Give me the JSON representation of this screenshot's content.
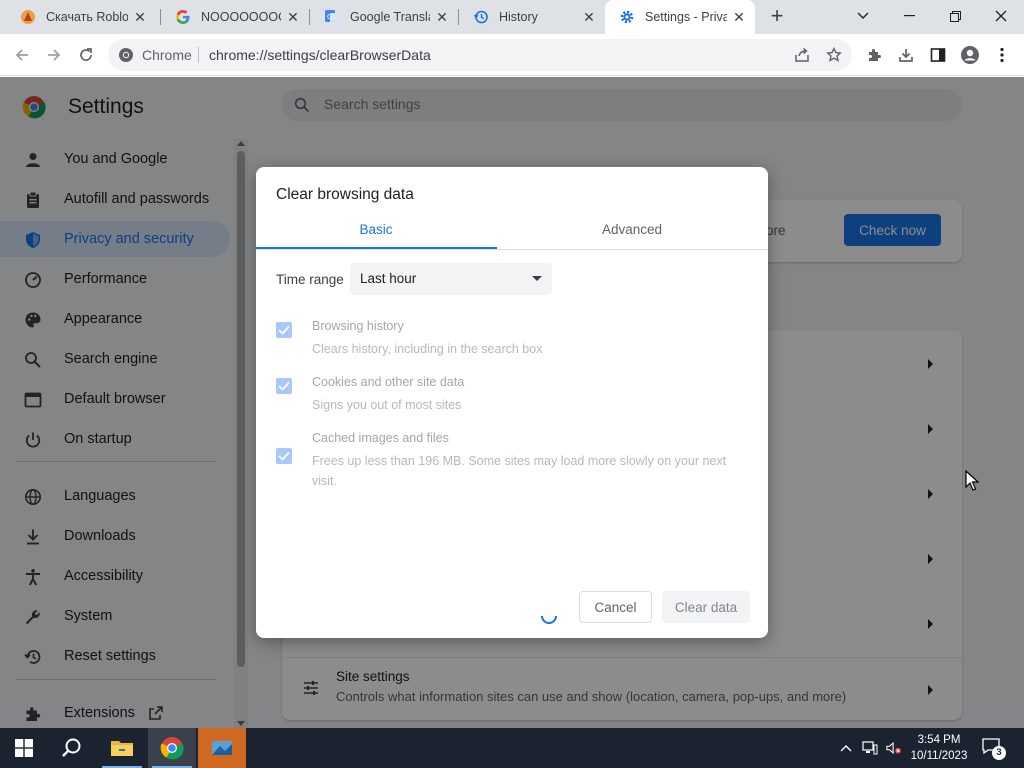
{
  "browser": {
    "tabs": [
      {
        "title": "Скачать Roblo",
        "favicon": "roblox-icon",
        "active": false
      },
      {
        "title": "NOOOOOOOC",
        "favicon": "google-icon",
        "active": false
      },
      {
        "title": "Google Translat",
        "favicon": "google-translate-icon",
        "active": false
      },
      {
        "title": "History",
        "favicon": "history-icon",
        "active": false
      },
      {
        "title": "Settings - Priva",
        "favicon": "settings-gear-icon",
        "active": true
      }
    ],
    "new_tab_symbol": "+",
    "window_controls": [
      "chevron-down-icon",
      "minimize-icon",
      "restore-icon",
      "close-icon"
    ]
  },
  "toolbar": {
    "site_chip": "Chrome",
    "url": "chrome://settings/clearBrowserData",
    "icons": [
      "back-icon",
      "forward-icon",
      "reload-icon",
      "share-icon",
      "bookmark-star-icon",
      "extensions-puzzle-icon",
      "download-icon",
      "side-panel-icon",
      "profile-avatar-icon",
      "menu-kebab-icon"
    ]
  },
  "settings": {
    "title": "Settings",
    "search_placeholder": "Search settings",
    "nav": [
      {
        "label": "You and Google",
        "icon": "person-icon",
        "selected": false
      },
      {
        "label": "Autofill and passwords",
        "icon": "clipboard-icon",
        "selected": false
      },
      {
        "label": "Privacy and security",
        "icon": "shield-icon",
        "selected": true
      },
      {
        "label": "Performance",
        "icon": "speedometer-icon",
        "selected": false
      },
      {
        "label": "Appearance",
        "icon": "palette-icon",
        "selected": false
      },
      {
        "label": "Search engine",
        "icon": "search-icon",
        "selected": false
      },
      {
        "label": "Default browser",
        "icon": "browser-window-icon",
        "selected": false
      },
      {
        "label": "On startup",
        "icon": "power-icon",
        "selected": false
      },
      {
        "label": "Languages",
        "icon": "globe-icon",
        "selected": false
      },
      {
        "label": "Downloads",
        "icon": "download-icon",
        "selected": false
      },
      {
        "label": "Accessibility",
        "icon": "accessibility-icon",
        "selected": false
      },
      {
        "label": "System",
        "icon": "wrench-icon",
        "selected": false
      },
      {
        "label": "Reset settings",
        "icon": "reset-history-icon",
        "selected": false
      },
      {
        "label": "Extensions",
        "icon": "puzzle-icon",
        "selected": false
      }
    ],
    "check_partial": "ore",
    "check_button": "Check now",
    "site_settings": {
      "title": "Site settings",
      "desc": "Controls what information sites can use and show (location, camera, pop-ups, and more)"
    }
  },
  "dialog": {
    "title": "Clear browsing data",
    "tabs": [
      "Basic",
      "Advanced"
    ],
    "active_tab": "Basic",
    "time_range_label": "Time range",
    "time_range_value": "Last hour",
    "options": [
      {
        "title": "Browsing history",
        "desc": "Clears history, including in the search box",
        "checked": true
      },
      {
        "title": "Cookies and other site data",
        "desc": "Signs you out of most sites",
        "checked": true
      },
      {
        "title": "Cached images and files",
        "desc": "Frees up less than 196 MB. Some sites may load more slowly on your next visit.",
        "checked": true
      }
    ],
    "cancel": "Cancel",
    "clear": "Clear data"
  },
  "taskbar": {
    "apps": [
      "windows-start-icon",
      "search-icon",
      "file-explorer-icon",
      "chrome-icon",
      "app-icon"
    ],
    "time": "3:54 PM",
    "date": "10/11/2023",
    "notification_count": "3"
  },
  "colors": {
    "accent": "#1a73e8",
    "nav_selected_bg": "#d6e4f8",
    "taskbar": "#1c2330"
  }
}
